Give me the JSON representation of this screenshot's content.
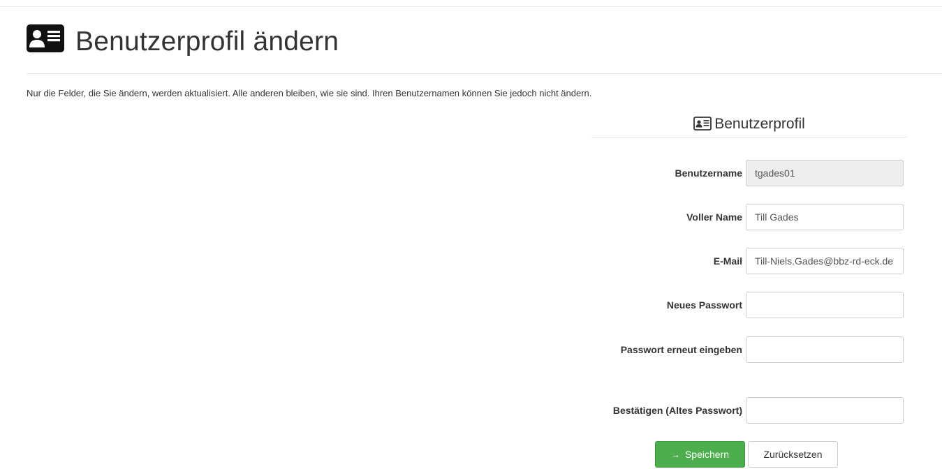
{
  "header": {
    "title": "Benutzerprofil ändern",
    "icon": "id-card-icon"
  },
  "intro_text": "Nur die Felder, die Sie ändern, werden aktualisiert. Alle anderen bleiben, wie sie sind. Ihren Benutzernamen können Sie jedoch nicht ändern.",
  "form": {
    "legend": "Benutzerprofil",
    "legend_icon": "id-card-outline-icon",
    "fields": {
      "username": {
        "label": "Benutzername",
        "value": "tgades01"
      },
      "fullname": {
        "label": "Voller Name",
        "value": "Till Gades"
      },
      "email": {
        "label": "E-Mail",
        "value": "Till-Niels.Gades@bbz-rd-eck.de"
      },
      "new_password": {
        "label": "Neues Passwort",
        "value": ""
      },
      "repeat_password": {
        "label": "Passwort erneut eingeben",
        "value": ""
      },
      "old_password": {
        "label": "Bestätigen (Altes Passwort)",
        "value": ""
      }
    },
    "buttons": {
      "save_label": "Speichern",
      "save_icon": "arrow-right-icon",
      "reset_label": "Zurücksetzen"
    }
  },
  "colors": {
    "save_button": "#4cae4c",
    "readonly_field": "#eeeeee",
    "text": "#333333"
  }
}
